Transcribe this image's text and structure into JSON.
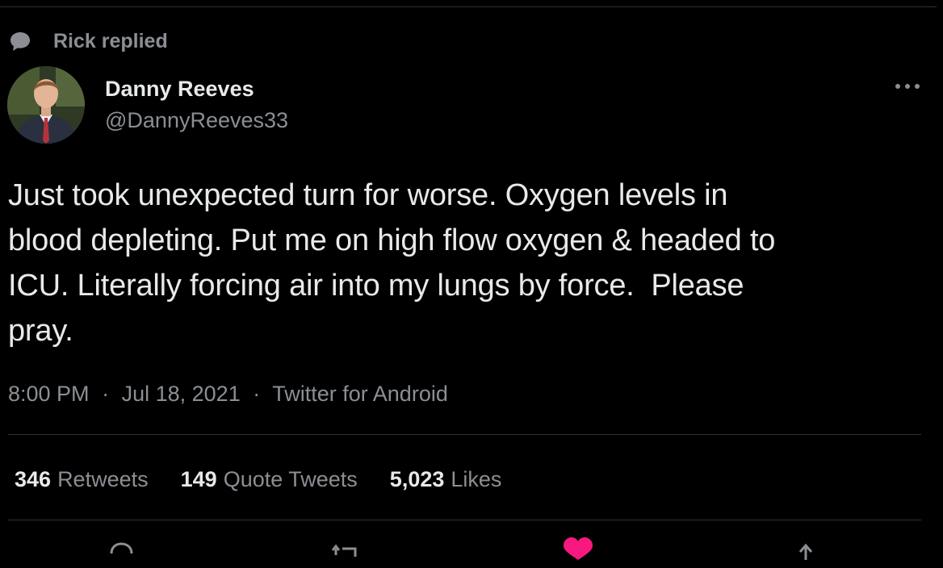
{
  "context": {
    "icon": "reply-bubble-icon",
    "text": "Rick replied"
  },
  "author": {
    "display_name": "Danny Reeves",
    "handle": "@DannyReeves33",
    "avatar": "avatar-photo"
  },
  "more_icon": "more-dots-icon",
  "tweet": {
    "text": "Just took unexpected turn for worse. Oxygen levels in\nblood depleting. Put me on high flow oxygen & headed to\nICU. Literally forcing air into my lungs by force.  Please\npray.",
    "time": "8:00 PM",
    "date": "Jul 18, 2021",
    "source": "Twitter for Android",
    "separator": "·"
  },
  "stats": {
    "retweets": {
      "count": "346",
      "label": "Retweets"
    },
    "quotes": {
      "count": "149",
      "label": "Quote Tweets"
    },
    "likes": {
      "count": "5,023",
      "label": "Likes"
    }
  },
  "actions": [
    "reply-icon",
    "retweet-icon",
    "like-icon",
    "share-icon"
  ],
  "colors": {
    "background": "#000000",
    "text_primary": "#e7e9ea",
    "text_secondary": "#8b8f94",
    "divider": "#2f3336",
    "like_active": "#f91880"
  }
}
